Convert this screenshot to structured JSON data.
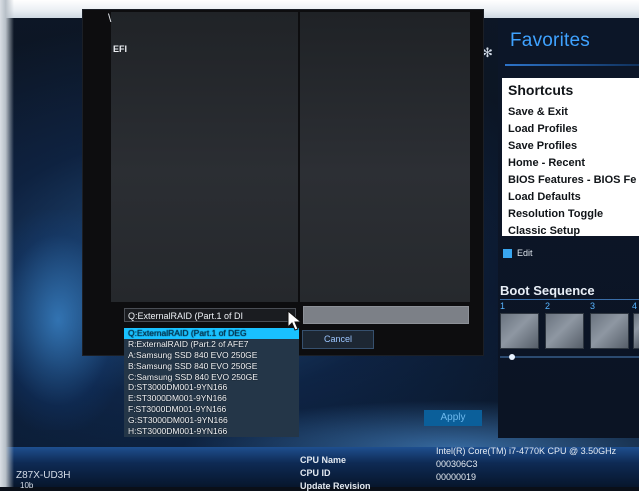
{
  "dialog": {
    "path_separator": "\\",
    "title": "EFI",
    "path_field_value": "Q:ExternalRAID (Part.1 of DI",
    "cancel_label": "Cancel",
    "drives": [
      "Q:ExternalRAID (Part.1 of DEG",
      "R:ExternalRAID (Part.2 of AFE7",
      "A:Samsung SSD 840 EVO 250GE",
      "B:Samsung SSD 840 EVO 250GE",
      "C:Samsung SSD 840 EVO 250GE",
      "D:ST3000DM001-9YN166",
      "E:ST3000DM001-9YN166",
      "F:ST3000DM001-9YN166",
      "G:ST3000DM001-9YN166",
      "H:ST3000DM001-9YN166"
    ],
    "selected_drive_index": 0
  },
  "favorites": {
    "title": "Favorites",
    "shortcuts_title": "Shortcuts",
    "shortcuts": [
      "Save & Exit",
      "Load Profiles",
      "Save Profiles",
      "Home - Recent",
      "BIOS Features - BIOS Fe",
      "Load Defaults",
      "Resolution Toggle",
      "Classic Setup"
    ],
    "edit_label": "Edit",
    "boot_sequence_title": "Boot Sequence",
    "boot_slots": [
      "1",
      "2",
      "3",
      "4"
    ]
  },
  "apply_label": "Apply",
  "footer": {
    "model": "Z87X-UD3H",
    "model_sub": "10b",
    "info_keys": [
      "CPU Name",
      "CPU ID",
      "Update Revision"
    ],
    "info_values": [
      "Intel(R) Core(TM) i7-4770K CPU @ 3.50GHz",
      "000306C3",
      "00000019"
    ]
  },
  "colors": {
    "accent_blue": "#3fa2ff",
    "selected_highlight": "#19c1ff",
    "panel_white": "#ffffff"
  }
}
